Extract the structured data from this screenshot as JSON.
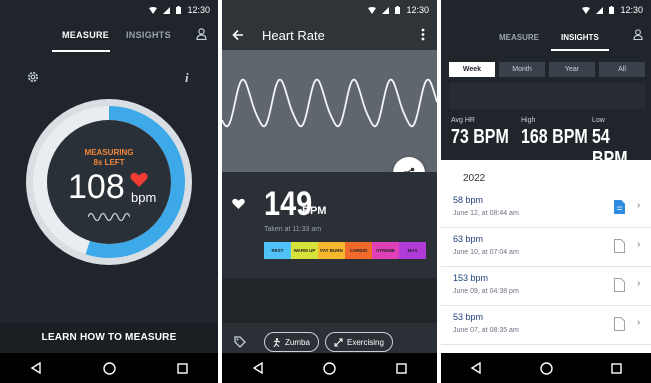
{
  "status": {
    "time": "12:30"
  },
  "measure_screen": {
    "tabs": [
      {
        "label": "MEASURE",
        "active": true
      },
      {
        "label": "INSIGHTS",
        "active": false
      }
    ],
    "measuring_label": "MEASURING",
    "time_left": "8s LEFT",
    "bpm_value": "108",
    "bpm_unit": "bpm",
    "info_glyph": "i",
    "learn_label": "LEARN HOW TO MEASURE",
    "progress": 0.55,
    "icons": [
      "gear-icon",
      "info-icon",
      "user-icon",
      "heart-icon",
      "pulse-wave-icon"
    ]
  },
  "result_screen": {
    "title": "Heart Rate",
    "bpm_value": "149",
    "bpm_unit": "BPM",
    "taken_at": "Taken at 11:33 am",
    "zones": [
      {
        "label": "REST",
        "color": "#4fc3f7"
      },
      {
        "label": "WARM UP",
        "color": "#d7e23a"
      },
      {
        "label": "FAT BURN",
        "color": "#f5b82e"
      },
      {
        "label": "CARDIO",
        "color": "#f06a2c"
      },
      {
        "label": "XTREME",
        "color": "#e040b7"
      },
      {
        "label": "MAX",
        "color": "#b13bd8"
      }
    ],
    "active_zone": "CARDIO",
    "tags": [
      {
        "label": "Zumba",
        "icon": "dance-icon"
      },
      {
        "label": "Exercising",
        "icon": "arrows-icon"
      }
    ]
  },
  "insights_screen": {
    "tabs": [
      {
        "label": "MEASURE",
        "active": false
      },
      {
        "label": "INSIGHTS",
        "active": true
      }
    ],
    "ranges": [
      {
        "label": "Week",
        "active": true
      },
      {
        "label": "Month",
        "active": false
      },
      {
        "label": "Year",
        "active": false
      },
      {
        "label": "All",
        "active": false
      }
    ],
    "stats": [
      {
        "label": "Avg HR",
        "value": "73 BPM"
      },
      {
        "label": "High",
        "value": "168 BPM"
      },
      {
        "label": "Low",
        "value": "54 BPM"
      }
    ],
    "year": "2022",
    "entries": [
      {
        "bpm": "58 bpm",
        "date": "June 12, at 08:44 am",
        "has_note": true
      },
      {
        "bpm": "63 bpm",
        "date": "June 10, at 07:04 am",
        "has_note": false
      },
      {
        "bpm": "153 bpm",
        "date": "June 09, at 04:38 pm",
        "has_note": false
      },
      {
        "bpm": "53 bpm",
        "date": "June 07, at 08:35 am",
        "has_note": false
      }
    ]
  },
  "colors": {
    "accent_blue": "#3da9e8",
    "heart_red": "#ef3b34",
    "orange": "#f0873a"
  }
}
